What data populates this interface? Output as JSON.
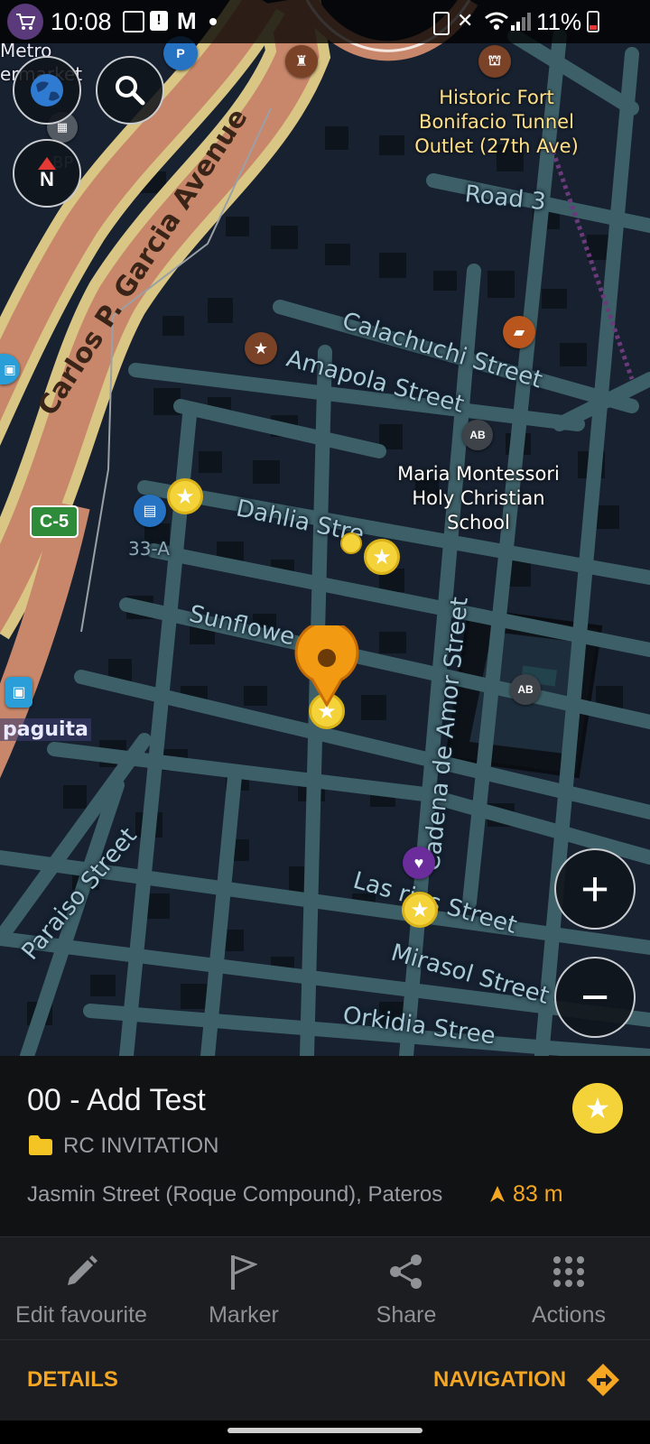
{
  "status_bar": {
    "time": "10:08",
    "battery": "11%"
  },
  "map": {
    "street_labels": {
      "avenue": "Carlos P. Garcia Avenue",
      "road3": "Road 3",
      "calachuchi": "Calachuchi Street",
      "amapola": "Amapola Street",
      "dahlia": "Dahlia Stre",
      "sunflower": "Sunflowe   eet",
      "amor": "Cadena de Amor Street",
      "paraiso": "Paraiso Street",
      "las_rias": "Las  rias Street",
      "mirasol": "Mirasol Street",
      "orkidia": "Orkidia Stree",
      "c5": "C-5",
      "num33a": "33-A",
      "metro1": "Metro",
      "metro2": "ermarket",
      "sampaguita": "paguita",
      "bp": "BP",
      "ab1": "AB",
      "ab2": "AB"
    },
    "poi_labels": {
      "fort": "Historic Fort Bonifacio Tunnel Outlet (27th Ave)",
      "school": "Maria Montessori Holy Christian School"
    },
    "controls": {
      "compass_letter": "N",
      "zoom_in": "+",
      "zoom_out": "−"
    }
  },
  "place": {
    "title": "00 - Add Test",
    "folder": "RC INVITATION",
    "address": "Jasmin Street (Roque Compound), Pateros",
    "distance": "83 m"
  },
  "actions": [
    {
      "label": "Edit favourite",
      "icon": "pencil-icon"
    },
    {
      "label": "Marker",
      "icon": "flag-icon"
    },
    {
      "label": "Share",
      "icon": "share-icon"
    },
    {
      "label": "Actions",
      "icon": "grid-icon"
    }
  ],
  "buttons": {
    "details": "DETAILS",
    "navigation": "NAVIGATION"
  },
  "colors": {
    "accent": "#f5a623",
    "favorite": "#f4d23a",
    "marker": "#f29a12",
    "road_major": "#d4a06f",
    "road_minor": "#3d5f67",
    "background": "#172130"
  }
}
